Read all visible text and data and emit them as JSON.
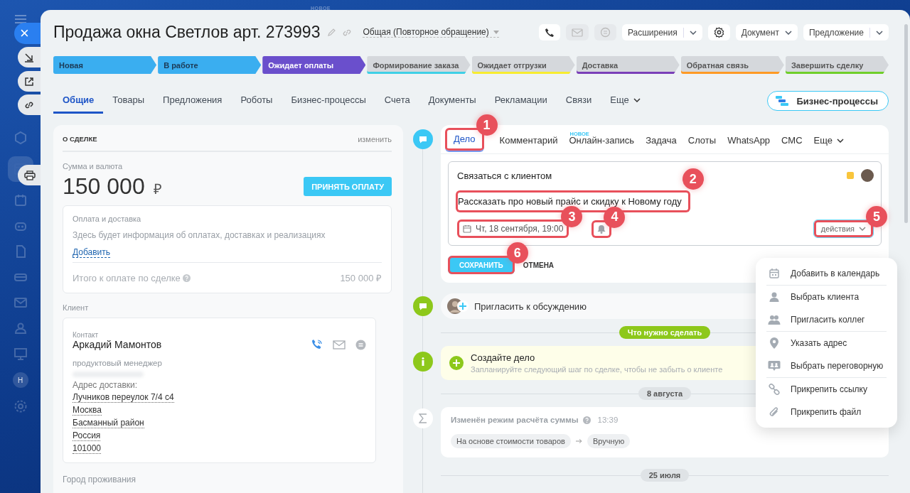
{
  "top_hint": "НОВОЕ",
  "launcher": {
    "close": "×",
    "avatar": "Н"
  },
  "title": "Продажа окна Светлов арт. 273993",
  "pipeline": "Общая (Повторное обращение)",
  "toolbar": {
    "extensions": "Расширения",
    "document": "Документ",
    "proposal": "Предложение"
  },
  "stages": [
    {
      "label": "Новая",
      "color": "#3aaef0",
      "filled": true
    },
    {
      "label": "В работе",
      "color": "#3aaef0",
      "filled": true
    },
    {
      "label": "Ожидает оплаты",
      "color": "#6a4fcc",
      "filled": true
    },
    {
      "label": "Формирование заказа",
      "color": "#3fd0e6",
      "filled": false
    },
    {
      "label": "Ожидает отгрузки",
      "color": "#f7ec2f",
      "filled": false
    },
    {
      "label": "Доставка",
      "color": "#7a3fb8",
      "filled": false
    },
    {
      "label": "Обратная связь",
      "color": "#ff9a24",
      "filled": false
    },
    {
      "label": "Завершить сделку",
      "color": "#6fcf2a",
      "filled": false
    }
  ],
  "tabs": [
    {
      "label": "Общие",
      "selected": true,
      "kind": "tab"
    },
    {
      "label": "Товары",
      "selected": false,
      "kind": "tab"
    },
    {
      "label": "Предложения",
      "selected": false,
      "kind": "tab"
    },
    {
      "label": "Роботы",
      "selected": false,
      "kind": "tab"
    },
    {
      "label": "Бизнес-процессы",
      "selected": false,
      "kind": "tab"
    },
    {
      "label": "Счета",
      "selected": false,
      "kind": "tab"
    },
    {
      "label": "Документы",
      "selected": false,
      "kind": "tab"
    },
    {
      "label": "Рекламации",
      "selected": false,
      "kind": "tab"
    },
    {
      "label": "Связи",
      "selected": false,
      "kind": "tab"
    },
    {
      "label": "Еще",
      "selected": false,
      "kind": "more"
    }
  ],
  "bp_button": "Бизнес-процессы",
  "deal": {
    "heading": "О СДЕЛКЕ",
    "edit": "изменить",
    "amount_label": "Сумма и валюта",
    "amount": "150 000",
    "currency": "₽",
    "pay_button": "ПРИНЯТЬ ОПЛАТУ",
    "payment": {
      "title": "Оплата и доставка",
      "note": "Здесь будет информация об оплатах, доставках и реализациях",
      "add": "Добавить",
      "total_label": "Итого к оплате по сделке",
      "total": "150 000 ₽"
    },
    "client_label": "Клиент",
    "contact": {
      "caption": "Контакт",
      "name": "Аркадий Мамонтов",
      "position": "продуктовый менеджер",
      "address_label": "Адрес доставки:",
      "address": [
        "Лучников переулок 7/4 с4",
        "Москва",
        "Басманный район",
        "Россия",
        "101000"
      ]
    },
    "next_section": "Город проживания"
  },
  "editor": {
    "tabs": [
      {
        "label": "Дело",
        "selected": true,
        "callout": "1"
      },
      {
        "label": "Комментарий",
        "selected": false
      },
      {
        "label": "Онлайн-запись",
        "selected": false,
        "badge": "НОВОЕ"
      },
      {
        "label": "Задача",
        "selected": false
      },
      {
        "label": "Слоты",
        "selected": false
      },
      {
        "label": "WhatsApp",
        "selected": false
      },
      {
        "label": "СМС",
        "selected": false
      },
      {
        "label": "Еще",
        "selected": false,
        "kind": "more"
      }
    ],
    "subject": "Связаться с клиентом",
    "description": {
      "text": "Рассказать про новый прайс и скидку к Новому году",
      "callout": "2"
    },
    "deadline": {
      "text": "Чт, 18 сентября, 19:00",
      "callout": "3"
    },
    "bell": {
      "callout": "4"
    },
    "actions": {
      "text": "действия",
      "callout": "5"
    },
    "save": {
      "text": "СОХРАНИТЬ",
      "callout": "6"
    },
    "cancel": "ОТМЕНА"
  },
  "menu": [
    [
      {
        "label": "Добавить в календарь",
        "kind": "calendar"
      }
    ],
    [
      {
        "label": "Выбрать клиента",
        "kind": "client"
      },
      {
        "label": "Пригласить коллег",
        "kind": "colleagues"
      }
    ],
    [
      {
        "label": "Указать адрес",
        "kind": "address"
      },
      {
        "label": "Выбрать переговорную",
        "kind": "room"
      }
    ],
    [
      {
        "label": "Прикрепить ссылку",
        "kind": "link"
      },
      {
        "label": "Прикрепить файл",
        "kind": "file"
      }
    ]
  ],
  "timeline": {
    "invite": "Пригласить к обсуждению",
    "todo_section": "Что нужно сделать",
    "todo": {
      "title": "Создайте дело",
      "hint": "Запланируйте следующий шаг по сделке, чтобы не забыть о клиенте"
    },
    "date": "8 августа",
    "event": {
      "title": "Изменён режим расчёта суммы",
      "time": "13:39",
      "from": "На основе стоимости товаров",
      "to": "Вручную"
    },
    "next_date": "25 июля"
  }
}
